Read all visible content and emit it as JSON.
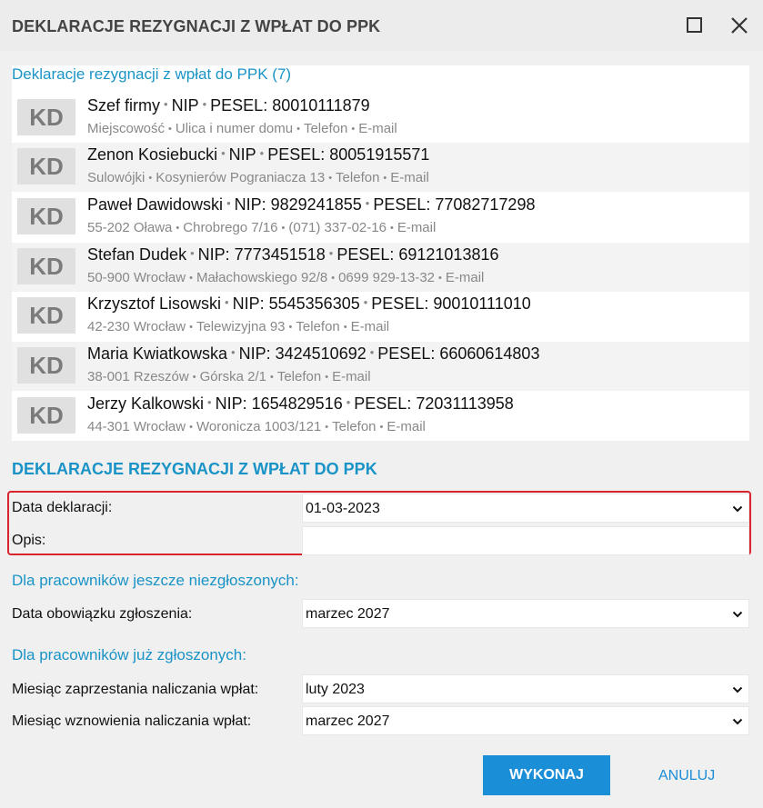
{
  "window": {
    "title": "DEKLARACJE REZYGNACJI Z WPŁAT DO PPK"
  },
  "list": {
    "title": "Deklaracje rezygnacji z wpłat do PPK (7)",
    "badge": "KD",
    "items": [
      {
        "main": [
          "Szef firmy",
          "NIP",
          "PESEL: 80010111879"
        ],
        "sub": [
          "Miejscowość",
          "Ulica i numer domu",
          "Telefon",
          "E-mail"
        ]
      },
      {
        "main": [
          "Zenon Kosiebucki",
          "NIP",
          "PESEL: 80051915571"
        ],
        "sub": [
          "Sulowójki",
          "Kosynierów Pograniacza 13",
          "Telefon",
          "E-mail"
        ]
      },
      {
        "main": [
          "Paweł Dawidowski",
          "NIP: 9829241855",
          "PESEL: 77082717298"
        ],
        "sub": [
          "55-202 Oława",
          "Chrobrego 7/16",
          "(071) 337-02-16",
          "E-mail"
        ]
      },
      {
        "main": [
          "Stefan Dudek",
          "NIP: 7773451518",
          "PESEL: 69121013816"
        ],
        "sub": [
          "50-900 Wrocław",
          "Małachowskiego 92/8",
          "0699 929-13-32",
          "E-mail"
        ]
      },
      {
        "main": [
          "Krzysztof Lisowski",
          "NIP: 5545356305",
          "PESEL: 90010111010"
        ],
        "sub": [
          "42-230 Wrocław",
          "Telewizyjna 93",
          "Telefon",
          "E-mail"
        ]
      },
      {
        "main": [
          "Maria Kwiatkowska",
          "NIP: 3424510692",
          "PESEL: 66060614803"
        ],
        "sub": [
          "38-001 Rzeszów",
          "Górska 2/1",
          "Telefon",
          "E-mail"
        ]
      },
      {
        "main": [
          "Jerzy Kalkowski",
          "NIP: 1654829516",
          "PESEL: 72031113958"
        ],
        "sub": [
          "44-301 Wrocław",
          "Woronicza 1003/121",
          "Telefon",
          "E-mail"
        ]
      }
    ]
  },
  "form": {
    "section_title": "DEKLARACJE REZYGNACJI Z WPŁAT DO PPK",
    "declaration_date_label": "Data deklaracji:",
    "declaration_date_value": "01-03-2023",
    "description_label": "Opis:",
    "description_value": "",
    "unregistered_group": "Dla pracowników jeszcze niezgłoszonych:",
    "registration_deadline_label": "Data obowiązku zgłoszenia:",
    "registration_deadline_value": "marzec 2027",
    "registered_group": "Dla pracowników już zgłoszonych:",
    "stop_month_label": "Miesiąc zaprzestania naliczania wpłat:",
    "stop_month_value": "luty 2023",
    "resume_month_label": "Miesiąc wznowienia naliczania wpłat:",
    "resume_month_value": "marzec 2027"
  },
  "buttons": {
    "execute": "WYKONAJ",
    "cancel": "ANULUJ"
  },
  "colors": {
    "accent": "#1a93c6",
    "primary_button": "#1a8ed6",
    "highlight_border": "#d9242d"
  }
}
